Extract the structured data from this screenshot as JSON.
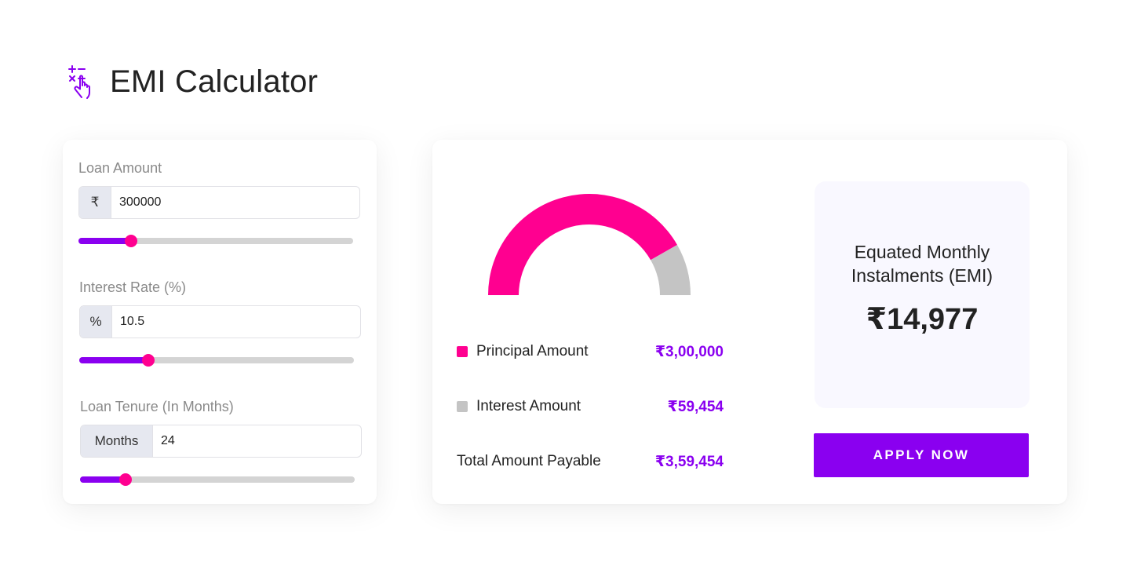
{
  "header": {
    "icon": "calculator-hand-icon",
    "title": "EMI Calculator"
  },
  "inputs": {
    "loan_amount": {
      "label": "Loan Amount",
      "prefix": "₹",
      "value": "300000",
      "slider_fraction": 0.19
    },
    "interest_rate": {
      "label": "Interest Rate (%)",
      "prefix": "%",
      "value": "10.5",
      "slider_fraction": 0.25
    },
    "tenure": {
      "label": "Loan Tenure (In Months)",
      "prefix": "Months",
      "value": "24",
      "slider_fraction": 0.165
    }
  },
  "breakdown": {
    "principal": {
      "label": "Principal Amount",
      "value": "₹3,00,000",
      "color": "#ff0090"
    },
    "interest": {
      "label": "Interest Amount",
      "value": "₹59,454",
      "color": "#c4c4c4"
    },
    "total": {
      "label": "Total Amount Payable",
      "value": "₹3,59,454"
    }
  },
  "chart_data": {
    "type": "pie",
    "categories": [
      "Principal Amount",
      "Interest Amount"
    ],
    "values": [
      300000,
      59454
    ],
    "colors": [
      "#ff0090",
      "#c4c4c4"
    ]
  },
  "emi": {
    "title": "Equated Monthly Instalments (EMI)",
    "value": "₹14,977"
  },
  "apply_button": {
    "label": "APPLY NOW"
  },
  "colors": {
    "accent": "#8a00f0",
    "pink": "#ff0090",
    "slider_track": "#d4d4d4",
    "interest_grey": "#c4c4c4"
  }
}
